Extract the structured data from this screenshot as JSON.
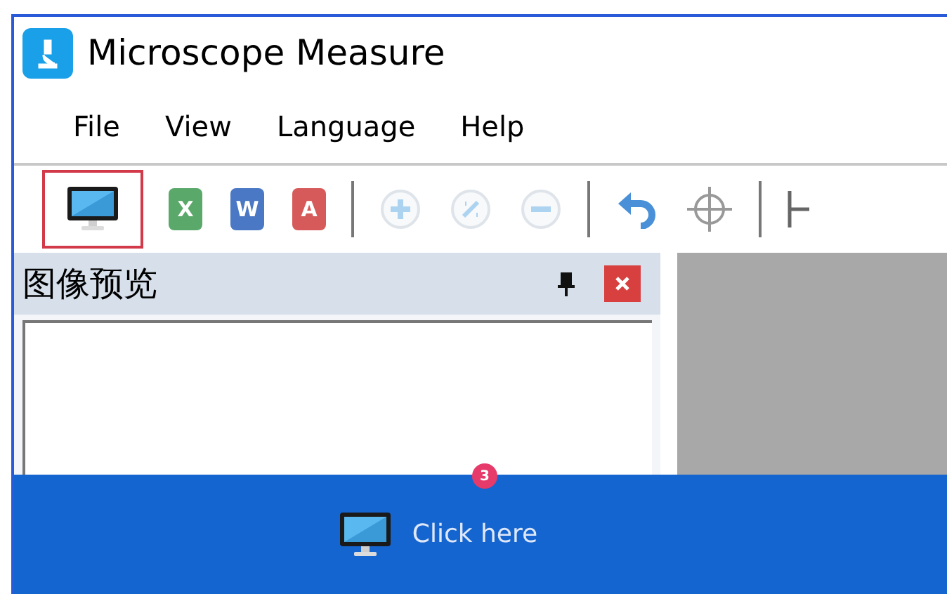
{
  "window": {
    "title": "Microscope Measure"
  },
  "menu": [
    {
      "label": "File"
    },
    {
      "label": "View"
    },
    {
      "label": "Language"
    },
    {
      "label": "Help"
    }
  ],
  "toolbar": [
    {
      "kind": "monitor",
      "selected": true,
      "disabled": false
    },
    {
      "kind": "doc",
      "glyph": "X",
      "color": "#5aa86a",
      "selected": false,
      "disabled": false
    },
    {
      "kind": "doc",
      "glyph": "W",
      "color": "#4a78c4",
      "selected": false,
      "disabled": false
    },
    {
      "kind": "doc",
      "glyph": "A",
      "color": "#d65a5a",
      "selected": false,
      "disabled": false
    },
    {
      "kind": "separator"
    },
    {
      "kind": "zoom-in",
      "selected": false,
      "disabled": true
    },
    {
      "kind": "zoom-fit",
      "selected": false,
      "disabled": true
    },
    {
      "kind": "zoom-out",
      "selected": false,
      "disabled": true
    },
    {
      "kind": "separator"
    },
    {
      "kind": "undo",
      "selected": false,
      "disabled": false
    },
    {
      "kind": "crosshair",
      "selected": false,
      "disabled": false
    },
    {
      "kind": "separator"
    },
    {
      "kind": "line",
      "selected": false,
      "disabled": false
    }
  ],
  "panel": {
    "title": "图像预览"
  },
  "banner": {
    "badge": "3",
    "label": "Click here"
  }
}
